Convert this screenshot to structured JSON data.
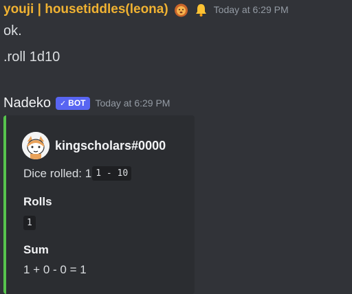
{
  "message1": {
    "username": "youji | housetiddles(leona)",
    "emojis": [
      "lion-emoji",
      "bell-emoji"
    ],
    "timestamp": "Today at 6:29 PM",
    "lines": [
      "ok.",
      ".roll 1d10"
    ]
  },
  "message2": {
    "username": "Nadeko",
    "badge": {
      "check": "✓",
      "text": "BOT"
    },
    "timestamp": "Today at 6:29 PM",
    "embed": {
      "accent": "#57c44d",
      "author": "kingscholars#0000",
      "description_prefix": "Dice rolled: 1",
      "description_code": "1 - 10",
      "fields": [
        {
          "name": "Rolls",
          "value": "1",
          "is_code": true
        },
        {
          "name": "Sum",
          "value": "1 + 0 - 0 = 1",
          "is_code": false
        }
      ]
    }
  },
  "colors": {
    "background": "#313338",
    "embed_background": "#2b2d31",
    "username1": "#f0b232",
    "badge": "#5865f2",
    "timestamp": "#949ba4"
  }
}
